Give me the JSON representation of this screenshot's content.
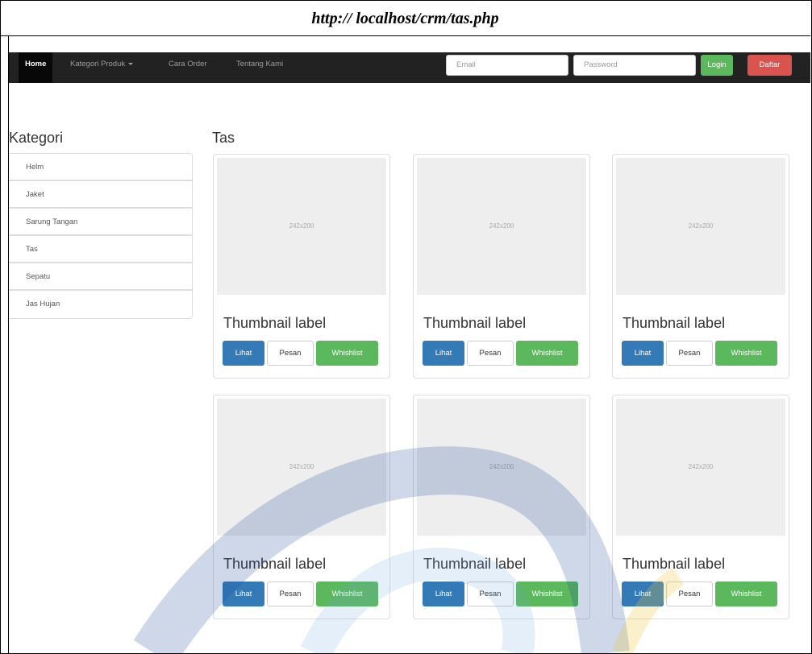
{
  "caption": "http:// localhost/crm/tas.php",
  "navbar": {
    "items": [
      {
        "label": "Home",
        "active": true
      },
      {
        "label": "Kategori Produk",
        "dropdown": true
      },
      {
        "label": "Cara Order"
      },
      {
        "label": "Tentang Kami"
      }
    ],
    "email_placeholder": "Email",
    "password_placeholder": "Password",
    "login_label": "Login",
    "daftar_label": "Daftar"
  },
  "sidebar": {
    "title": "Kategori",
    "items": [
      {
        "label": "Helm"
      },
      {
        "label": "Jaket"
      },
      {
        "label": "Sarung Tangan"
      },
      {
        "label": "Tas"
      },
      {
        "label": "Sepatu"
      },
      {
        "label": "Jas Hujan"
      }
    ]
  },
  "main": {
    "title": "Tas",
    "products": [
      {
        "placeholder": "242x200",
        "label": "Thumbnail label",
        "lihat": "Lihat",
        "pesan": "Pesan",
        "wishlist": "Whishlist"
      },
      {
        "placeholder": "242x200",
        "label": "Thumbnail label",
        "lihat": "Lihat",
        "pesan": "Pesan",
        "wishlist": "Whishlist"
      },
      {
        "placeholder": "242x200",
        "label": "Thumbnail label",
        "lihat": "Lihat",
        "pesan": "Pesan",
        "wishlist": "Whishlist"
      },
      {
        "placeholder": "242x200",
        "label": "Thumbnail label",
        "lihat": "Lihat",
        "pesan": "Pesan",
        "wishlist": "Whishlist"
      },
      {
        "placeholder": "242x200",
        "label": "Thumbnail label",
        "lihat": "Lihat",
        "pesan": "Pesan",
        "wishlist": "Whishlist"
      },
      {
        "placeholder": "242x200",
        "label": "Thumbnail label",
        "lihat": "Lihat",
        "pesan": "Pesan",
        "wishlist": "Whishlist"
      }
    ]
  },
  "colors": {
    "navbar_bg": "#222222",
    "primary": "#337ab7",
    "success": "#5cb85c",
    "danger": "#d9534f"
  }
}
